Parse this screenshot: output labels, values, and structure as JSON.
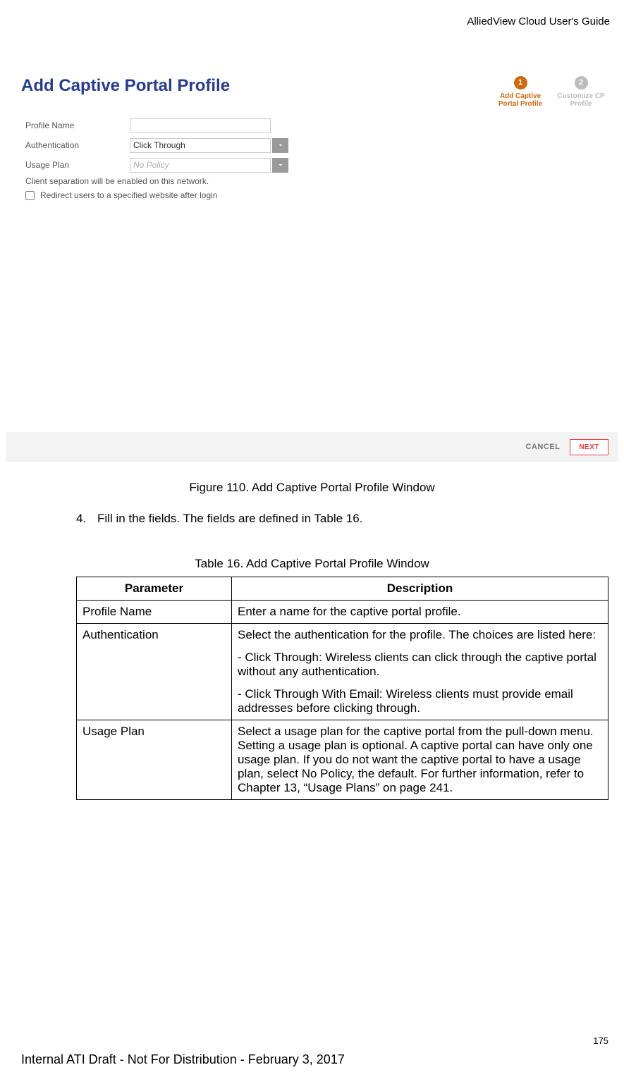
{
  "header": {
    "doc_title": "AlliedView Cloud User's Guide"
  },
  "screenshot": {
    "title": "Add Captive Portal Profile",
    "stepper": {
      "step1": {
        "num": "1",
        "label": "Add Captive\nPortal Profile"
      },
      "step2": {
        "num": "2",
        "label": "Customize CP\nProfile"
      }
    },
    "form": {
      "profile_name_label": "Profile Name",
      "profile_name_value": "",
      "auth_label": "Authentication",
      "auth_value": "Click Through",
      "usage_label": "Usage Plan",
      "usage_placeholder": "No Policy",
      "note": "Client separation will be enabled on this network.",
      "redirect_label": "Redirect users to a specified website after login"
    },
    "buttons": {
      "cancel": "CANCEL",
      "next": "NEXT"
    }
  },
  "figure_caption": "Figure 110. Add Captive Portal Profile Window",
  "step4": {
    "num": "4.",
    "text": "Fill in the fields. The fields are defined in Table 16."
  },
  "table_caption": "Table 16. Add Captive Portal Profile Window",
  "table": {
    "headers": {
      "param": "Parameter",
      "desc": "Description"
    },
    "rows": [
      {
        "param": "Profile Name",
        "desc": [
          "Enter a name for the captive portal profile."
        ]
      },
      {
        "param": "Authentication",
        "desc": [
          "Select the authentication for the profile. The choices are listed here:",
          "- Click Through: Wireless clients can click through the captive portal without any authentication.",
          "- Click Through With Email: Wireless clients must provide email addresses before clicking through."
        ]
      },
      {
        "param": "Usage Plan",
        "desc": [
          "Select a usage plan for the captive portal from the pull-down menu. Setting a usage plan is optional. A captive portal can have only one usage plan. If you do not want the captive portal to have a usage plan, select No Policy, the default. For further information, refer to Chapter 13, “Usage Plans” on page 241."
        ]
      }
    ]
  },
  "page_number": "175",
  "footer": "Internal ATI Draft - Not For Distribution - February 3, 2017"
}
